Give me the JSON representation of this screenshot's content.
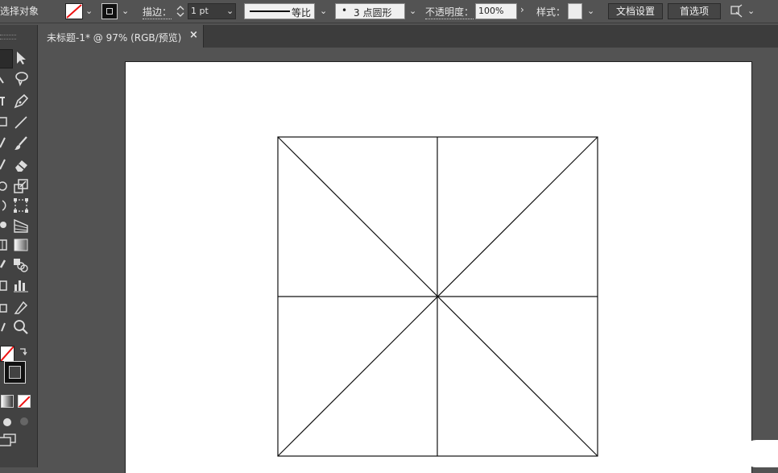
{
  "control_bar": {
    "select_label": "选择对象",
    "stroke_label": "描边：",
    "stroke_weight": "1 pt",
    "profile_label": "等比",
    "brush_label": "3 点圆形",
    "opacity_label": "不透明度：",
    "opacity_value": "100%",
    "style_label": "样式：",
    "doc_setup_label": "文档设置",
    "preferences_label": "首选项"
  },
  "document_tab": {
    "title": "未标题-1* @ 97% (RGB/预览)",
    "close_glyph": "×"
  }
}
